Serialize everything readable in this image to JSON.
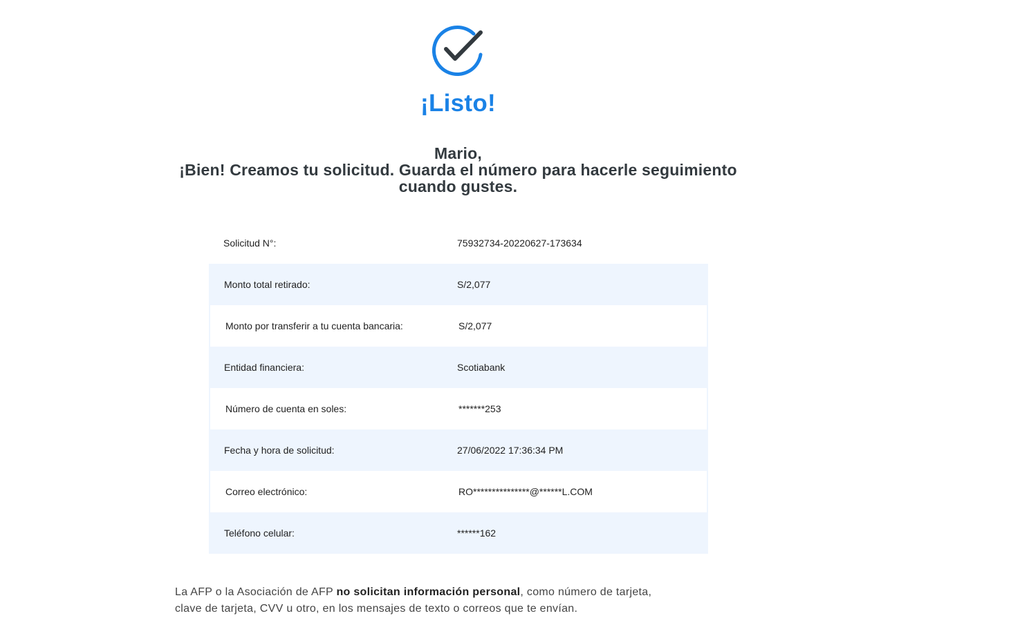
{
  "icon": {
    "name": "check-circle-icon",
    "accent": "#1a82e6",
    "check_color": "#333a3f"
  },
  "title": "¡Listo!",
  "message": {
    "line1": "Mario,",
    "line2": "¡Bien! Creamos tu solicitud. Guarda el número para hacerle seguimiento",
    "line3": "cuando gustes."
  },
  "summary": [
    {
      "label": "Solicitud N°:",
      "value": "75932734-20220627-173634"
    },
    {
      "label": "Monto total retirado:",
      "value": "S/2,077"
    },
    {
      "label": "Monto por transferir a tu cuenta bancaria:",
      "value": "S/2,077"
    },
    {
      "label": "Entidad financiera:",
      "value": "Scotiabank"
    },
    {
      "label": "Número de cuenta en soles:",
      "value": "*******253"
    },
    {
      "label": "Fecha y hora de solicitud:",
      "value": "27/06/2022 17:36:34 PM"
    },
    {
      "label": "Correo electrónico:",
      "value": "RO***************@******L.COM"
    },
    {
      "label": "Teléfono celular:",
      "value": "******162"
    }
  ],
  "notice": {
    "prefix": "La AFP o la Asociación de AFP ",
    "bold": "no solicitan información personal",
    "suffix": ", como número de tarjeta, clave de tarjeta, CVV u otro, en los mensajes de texto o correos que te envían."
  },
  "colors": {
    "accent": "#1a82e6",
    "row_shade": "#eef5fe",
    "heading": "#333a3f"
  }
}
